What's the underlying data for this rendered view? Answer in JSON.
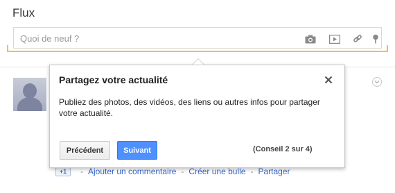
{
  "header": {
    "title": "Flux"
  },
  "share_box": {
    "placeholder": "Quoi de neuf ?",
    "icons": [
      "camera-icon",
      "video-icon",
      "link-icon",
      "location-pin-icon"
    ]
  },
  "post": {
    "avatar": "avatar",
    "menu_icon": "chevron-down-icon",
    "actions": {
      "plus_one": "+1",
      "comment": "Ajouter un commentaire",
      "hangout": "Créer une bulle",
      "share": "Partager",
      "separator": "-"
    }
  },
  "tooltip": {
    "title": "Partagez votre actualité",
    "body": "Publiez des photos, des vidéos, des liens ou autres infos pour partager votre actualité.",
    "prev_label": "Précédent",
    "next_label": "Suivant",
    "step_label": "(Conseil 2 sur 4)",
    "close_icon": "close-icon"
  },
  "colors": {
    "accent_blue": "#4d90fe",
    "share_bracket": "#f0c050",
    "link_blue": "#3366cc"
  }
}
